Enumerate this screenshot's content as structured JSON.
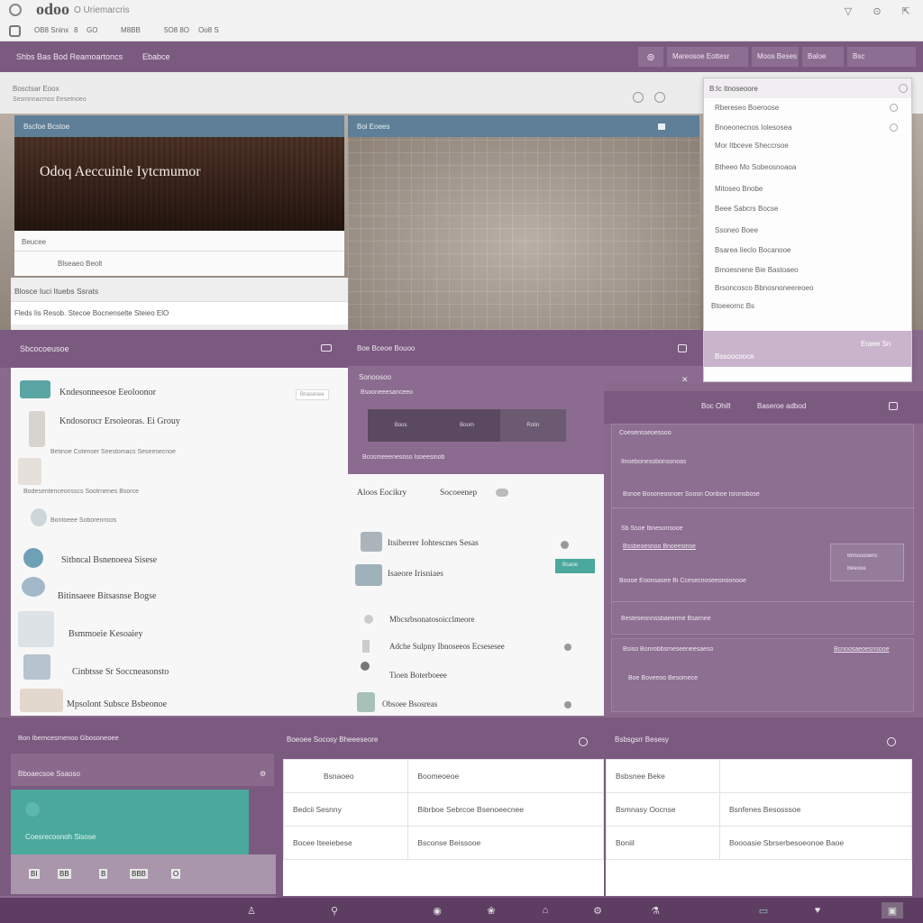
{
  "colors": {
    "brand": "#7b5a80",
    "teal": "#4aa89c",
    "header_bg": "#5e7f97",
    "bar": "#fafafa"
  },
  "titlebar": {
    "logo": "odoo",
    "title": "O Uriemarcris",
    "controls": [
      "▽",
      "⊙",
      "⇱"
    ]
  },
  "toolbar": {
    "items": [
      "OB8 Sninx",
      "8",
      "GO",
      "M8BB",
      "5O8 8O",
      "Oo8 S"
    ]
  },
  "menubar": {
    "left": "Shbs Bas Bod  Reamoartoncs",
    "center": "Ebabce",
    "buttons": [
      "Mareosoe Eottesr",
      "Moos Beses",
      "Baloe",
      "Bsc"
    ]
  },
  "sub": {
    "line1": "Bosctsar Eoox",
    "line2": "Sesmnnacmos Eesetnoeo"
  },
  "panel_a": {
    "header": "Bscfoe Bcstoe",
    "hero_text": "Odoq Aeccuinle Iytcmumor",
    "row1": "Beucee",
    "row2": "Blseaeo Beolt"
  },
  "panel_a_bottom": {
    "title": "Blosce Iuci Ituebs Ssrats",
    "text": "Fleds Iis Resob. Stecoe Bocnenselte Steieo ElO"
  },
  "panel_b": {
    "header": "Boi Eoees"
  },
  "dropdown": {
    "title": "B:Ic Itnoseoore",
    "items": [
      "Rbereseo Boeroose",
      "Bnoeonecnos Iolesosea",
      "Mor Itbceve Sheccrsoe",
      "Btheeo Mo Sobeosnoaoa",
      "Mitoseo Bnobe",
      "Beee Sabcrs Bocse",
      "Ssoneo Boee",
      "Bsarea Iieclo Bocanooe",
      "Bmoesnene Bie Bastoaeo",
      "Brsoncosco Bbnosnoneereoeo",
      "Btoeeornc Bs"
    ],
    "footer_right": "Eraee Sn",
    "footer_left": "Bssoocooce"
  },
  "left_list": {
    "title": "Sbcocoeusoe",
    "badge": "Bnasesee",
    "items": [
      "Kndesonneesoe Eeoloonor",
      "Kndosorocr Ersoieoras. Ei Grouy",
      "Betinoe Cotenser Seestomacs Seseesecnoe",
      "Bodesentenceonsscs Sootrnenes Bsorce",
      "Bontoeee Soborenrocis",
      "Sitbncal Bsnenoeea Sisese",
      "Bitinsaeee Bitsasnse Bogse",
      "Bsmmoeie Kesoaiey",
      "Cinbtsse Sr Soccneasonsto",
      "Mpsolont Subsce Bsbeonoe"
    ]
  },
  "mid_panel": {
    "title": "Boe Bceoe Bouoo",
    "line1": "Sonoosoo",
    "line2": "Bsooneeesanceeo",
    "buttons": [
      "Boos",
      "Boom",
      "Rotin"
    ],
    "line3": "Bcosmeeenesoso Isoeesinob"
  },
  "center_list": {
    "tab1": "Aloos Eocikry",
    "tab2": "Socoeenep",
    "items": [
      "Itsiberrer Iohtescnes Sesas",
      "Isaeore Irisniaes",
      "Mbcsrbsonatosoicclmeore",
      "Adche Sulpny Ibnoseeos Ecsesesee",
      "Tioen Boterboeee",
      "Obsoee Bsosreas"
    ],
    "badge": "Bsaoe"
  },
  "right_panel": {
    "header_left": "Boc Ohilf",
    "header_right": "Baseroe adbod",
    "card_title": "Coesensseoessoo",
    "rows": [
      "Ilnoebonesobonsonoas",
      "Bsnoe Bosoneosnoer Soosn Oonboe Isronsbose",
      "Sb Ssoe Ibnesonsooe",
      "Bssbeoesnoo Bnoeesinse",
      "Boooe Eoonsasee Bi Ccesecnoseeonoonooe",
      "Besteseonnssbaeerme Bsarnee"
    ],
    "card_box": {
      "l1": "Bnnosooens",
      "l2": "Beeooe"
    },
    "bottom_left": "Bsiso Bonrobbsmeseeneesaeso",
    "bottom_right": "Bcnoosaeoesnsooe",
    "bottom_2": "Boe Boveeoo Besomece"
  },
  "bottom_left": {
    "title": "Bon Ibemcesmenoo Gbosoneoee",
    "sub": "Bboaecsoe Ssaoso",
    "teal_text": "Coesrecoonoh Sisose",
    "icons": [
      "BI",
      "BB",
      "B",
      "BBB",
      "O"
    ]
  },
  "bottom_mid": {
    "title": "Boeoee Socosy Bheeeseore",
    "rows": [
      [
        "Bsnaoeo",
        "Boomeoeoe"
      ],
      [
        "Bedcii Sesnny",
        "Bibrboe Sebrcoe Bsenoeecnee"
      ],
      [
        "Bocee Iteeiebese",
        "Bsconse Beissooe"
      ]
    ]
  },
  "bottom_right": {
    "title": "Bsbsgsrr Besesy",
    "rows": [
      [
        "Bsbsnee Beke",
        ""
      ],
      [
        "Bsmnasy Oocnse",
        "Bsnfenes Besosssoe"
      ],
      [
        "Boniil",
        "Boooasie Sbrserbesoeonoe Baoe"
      ]
    ]
  },
  "taskbar": {
    "icons": [
      "♙",
      "⚲",
      "◉",
      "❀",
      "⌂",
      "⚙",
      "⚗",
      "▭",
      "♥",
      "▣"
    ]
  }
}
